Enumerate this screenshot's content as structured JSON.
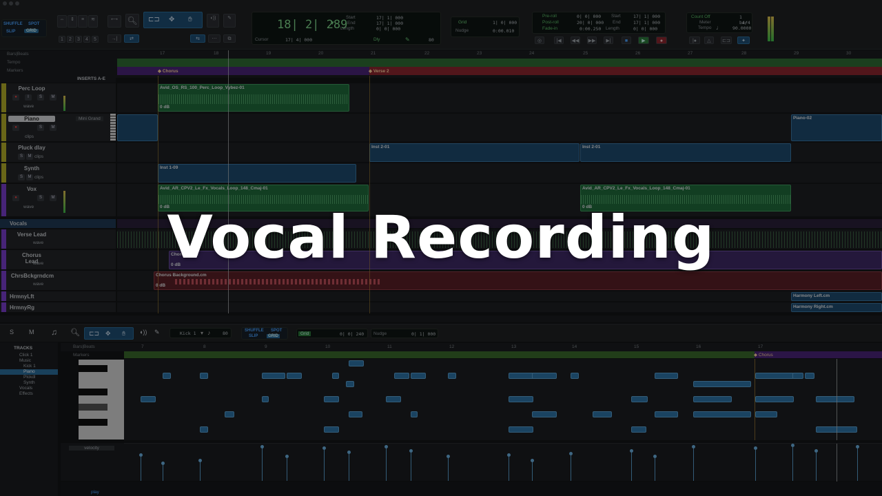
{
  "title_overlay": "Vocal Recording",
  "colors": {
    "accent_blue": "#2c6e9e",
    "audio_green": "#1f6b3b",
    "midi_blue": "#1e4a6e",
    "marker_purple": "#4a2579",
    "marker_red": "#8e2630"
  },
  "toolbar": {
    "modes": [
      "SHUFFLE",
      "SPOT",
      "SLIP",
      "GRID"
    ],
    "zoom_presets": [
      "1",
      "2",
      "3",
      "4",
      "5"
    ],
    "counter_main": "18| 2| 289",
    "counter_labels": {
      "start": "Start",
      "end": "End",
      "length": "Length"
    },
    "counter_values": {
      "start": "17| 1| 000",
      "end": "17| 1| 000",
      "length": "0| 0| 000"
    },
    "cursor_label": "Cursor",
    "cursor_value": "17| 4| 000",
    "dly_label": "Dly",
    "dly_value": "80",
    "grid_label": "Grid",
    "grid_value": "1| 0| 000",
    "nudge_label": "Nudge",
    "nudge_value": "0:00.010",
    "preroll_label": "Pre-roll",
    "preroll_value": "0| 0| 000",
    "postroll_label": "Post-roll",
    "postroll_value": "20| 0| 000",
    "fadein_label": "Fade-in",
    "fadein_value": "0:00.250",
    "tr_start_label": "Start",
    "tr_start_value": "17| 1| 000",
    "tr_end_label": "End",
    "tr_end_value": "17| 1| 000",
    "tr_length_label": "Length",
    "tr_length_value": "0| 0| 000",
    "countoff_label": "Count Off",
    "countoff_value": "1 bar",
    "meter_label": "Meter",
    "meter_value": "4/4",
    "tempo_label": "Tempo",
    "tempo_value": "90.0000"
  },
  "rulers": {
    "bars": "Bars|Beats",
    "tempo": "Tempo",
    "markers": "Markers"
  },
  "bar_numbers": [
    "17",
    "18",
    "19",
    "20",
    "21",
    "22",
    "23",
    "24",
    "25",
    "26",
    "27",
    "28",
    "29",
    "30"
  ],
  "markers": [
    {
      "label": "Chorus"
    },
    {
      "label": "Verse 2"
    }
  ],
  "inserts_header": "INSERTS A-E",
  "tracks": [
    {
      "name": "Perc Loop",
      "view": "wave",
      "color": "#b6b02a"
    },
    {
      "name": "Piano",
      "view": "clips",
      "color": "#b6b02a",
      "insert": "Mini Grand"
    },
    {
      "name": "Pluck dlay",
      "view": "clips",
      "color": "#b6b02a"
    },
    {
      "name": "Synth",
      "view": "clips",
      "color": "#b6b02a"
    },
    {
      "name": "Vox",
      "view": "wave",
      "color": "#7a3fcf"
    },
    {
      "name": "Vocals",
      "view": "",
      "color": "#2c6e9e"
    },
    {
      "name": "Verse Lead",
      "view": "wave",
      "color": "#7a3fcf"
    },
    {
      "name": "Chorus Lead",
      "view": "wave",
      "color": "#7a3fcf"
    },
    {
      "name": "ChrsBckgrndcm",
      "view": "wave",
      "color": "#7a3fcf"
    },
    {
      "name": "HrmnyLft",
      "view": "",
      "color": "#7a3fcf"
    },
    {
      "name": "HrmnyRg",
      "view": "",
      "color": "#7a3fcf"
    }
  ],
  "clips": {
    "perc": "Avid_OS_RS_100_Perc_Loop_Vybez-01",
    "perc_gain": "0 dB",
    "piano2": "Piano-02",
    "inst2a": "Inst 2-01",
    "inst2b": "Inst 2-01",
    "inst1": "Inst 1-09",
    "vox1": "Avid_AR_CPV2_Le_Fx_Vocals_Loop_148_Cmaj-01",
    "vox1_gain": "0 dB",
    "vox2": "Avid_AR_CPV2_Le_Fx_Vocals_Loop_148_Cmaj-01",
    "vox2_gain": "0 dB",
    "chorus_lead": "Chorus Lead",
    "chorus_lead_gain": "0 dB",
    "chorus_bg": "Chorus Background.cm",
    "chorus_bg_gain": "0 dB",
    "harm_left": "Harmony Left.cm",
    "harm_right": "Harmony Right.cm"
  },
  "midi_editor": {
    "instrument": "Kick 1",
    "velocity_value": "80",
    "grid_label": "Grid",
    "grid_value": "0| 0| 240",
    "nudge_label": "Nudge",
    "nudge_value": "0| 1| 000",
    "modes": [
      "SHUFFLE",
      "SPOT",
      "SLIP",
      "GRID"
    ],
    "tracks_header": "TRACKS",
    "tracks_list": [
      "Click 1",
      "Music",
      "Kick 1",
      "Piano",
      "Plckdl",
      "Synth",
      "Vocals",
      "Effects"
    ],
    "ruler_bars": "Bars|Beats",
    "ruler_markers": "Markers",
    "bar_numbers": [
      "7",
      "8",
      "9",
      "10",
      "11",
      "12",
      "13",
      "14",
      "15",
      "16",
      "17"
    ],
    "marker": "Chorus",
    "lane_label": "velocity",
    "footer": "play"
  }
}
